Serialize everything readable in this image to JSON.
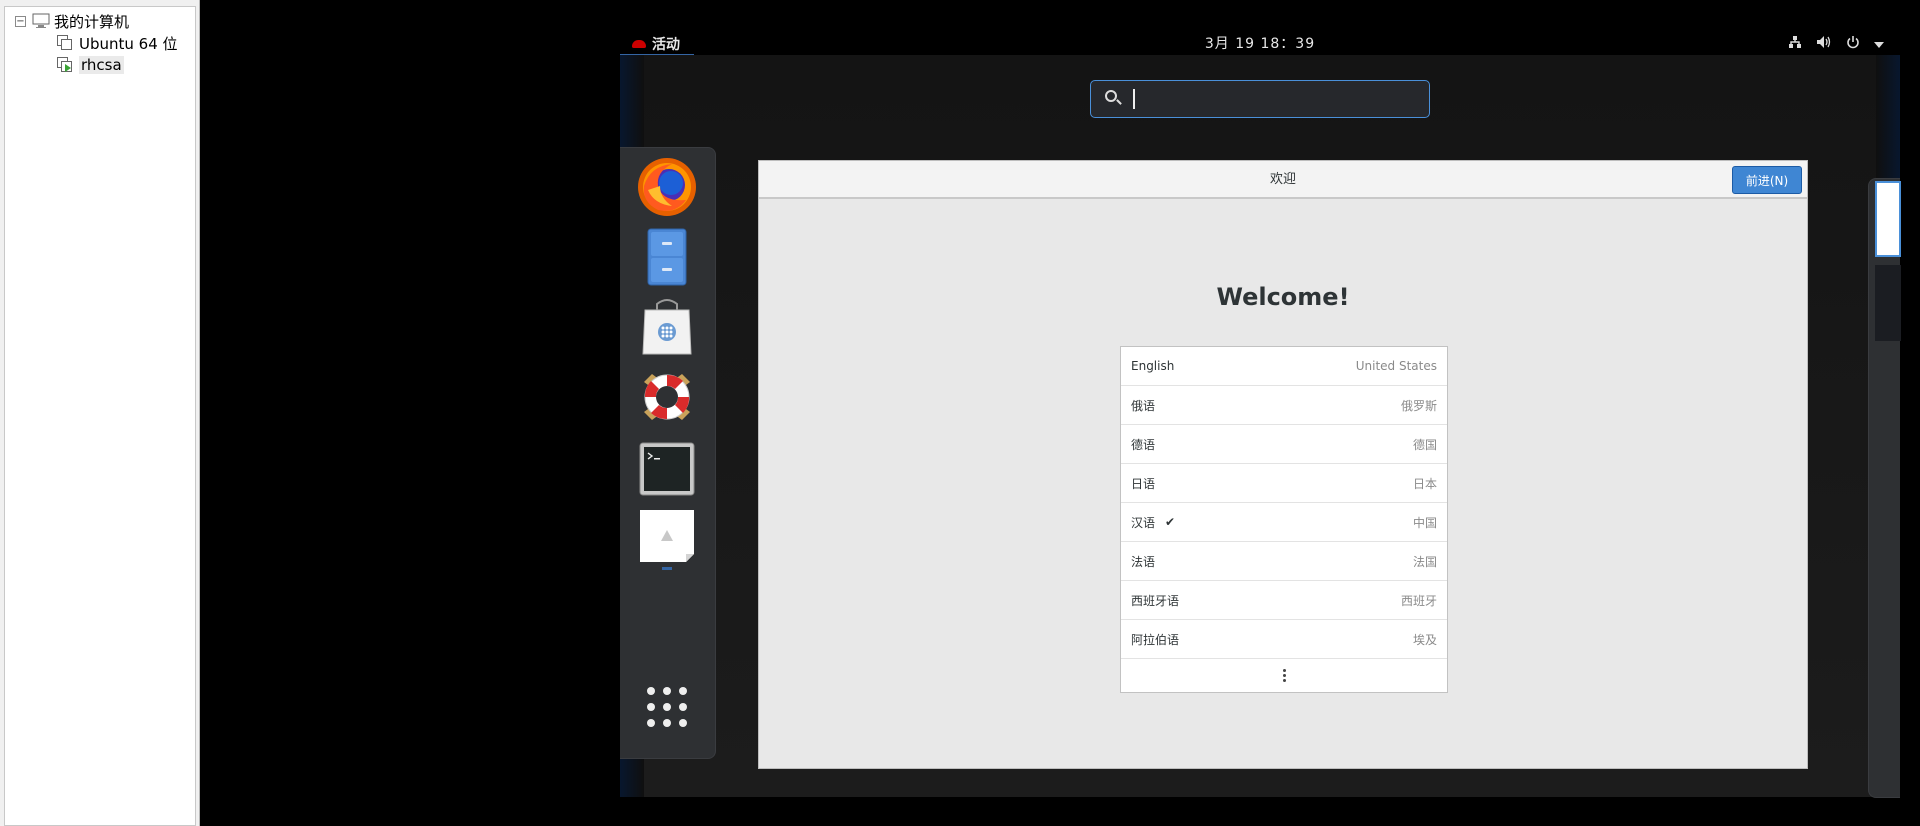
{
  "library": {
    "root_label": "我的计算机",
    "items": [
      {
        "label": "Ubuntu 64 位"
      },
      {
        "label": "rhcsa"
      }
    ]
  },
  "topbar": {
    "activities": "活动",
    "clock": "3月 19  18：39"
  },
  "search": {
    "value": ""
  },
  "dash": {
    "apps": [
      {
        "icon": "firefox-icon"
      },
      {
        "icon": "files-icon"
      },
      {
        "icon": "software-icon"
      },
      {
        "icon": "help-icon"
      },
      {
        "icon": "terminal-icon"
      },
      {
        "icon": "welcome-app-icon"
      },
      {
        "icon": "show-applications-icon"
      }
    ]
  },
  "window": {
    "title": "欢迎",
    "next_button": "前进(N)",
    "heading": "Welcome!",
    "languages": [
      {
        "name": "English",
        "region": "United States",
        "checked": false
      },
      {
        "name": "俄语",
        "region": "俄罗斯",
        "checked": false
      },
      {
        "name": "德语",
        "region": "德国",
        "checked": false
      },
      {
        "name": "日语",
        "region": "日本",
        "checked": false
      },
      {
        "name": "汉语",
        "region": "中国",
        "checked": true,
        "check_mark": "✔"
      },
      {
        "name": "法语",
        "region": "法国",
        "checked": false
      },
      {
        "name": "西班牙语",
        "region": "西班牙",
        "checked": false
      },
      {
        "name": "阿拉伯语",
        "region": "埃及",
        "checked": false
      }
    ]
  },
  "colors": {
    "accent": "#3f86d3",
    "focus_ring": "#4a90d9",
    "redhat": "#cc0000"
  }
}
